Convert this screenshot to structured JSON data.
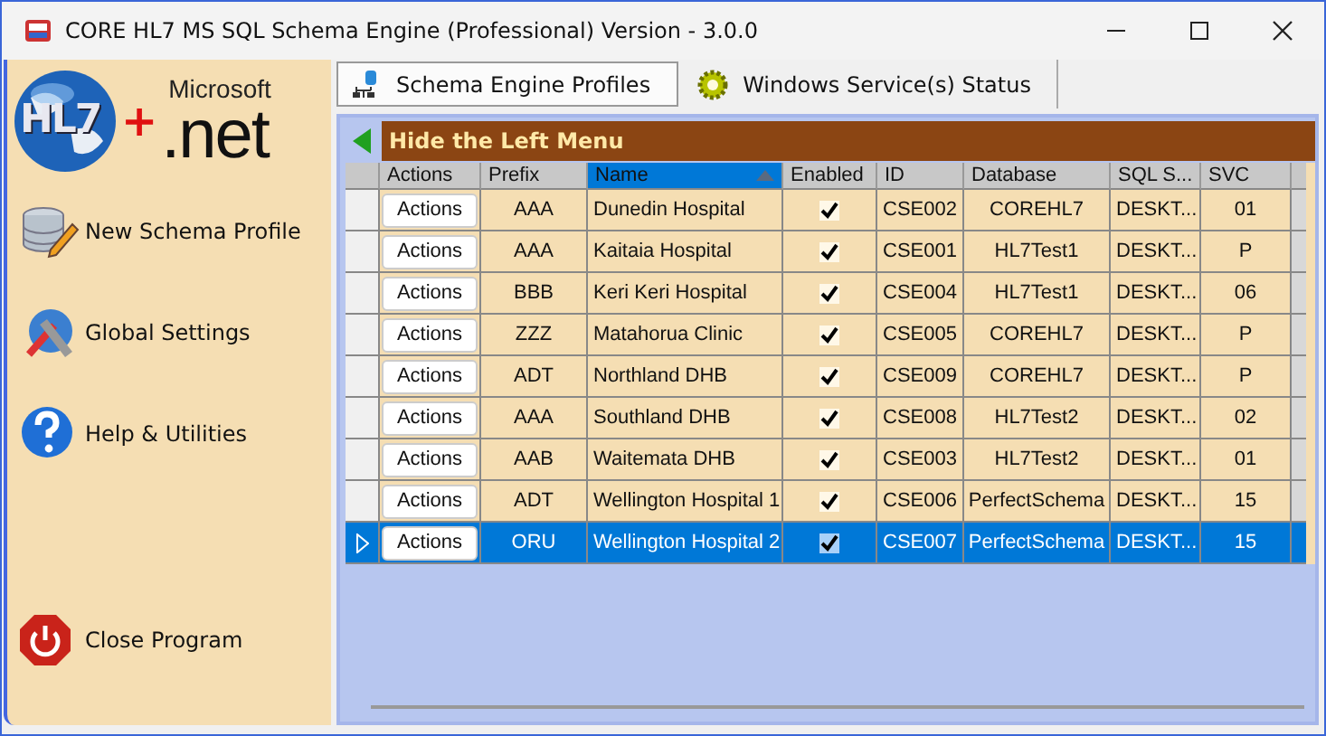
{
  "window": {
    "title": "CORE HL7 MS SQL Schema Engine (Professional) Version - 3.0.0"
  },
  "logo": {
    "left": "HL7",
    "plus": "+",
    "brand": "Microsoft",
    "right": ".net"
  },
  "sidebar": {
    "items": [
      {
        "label": "New Schema Profile",
        "kind": "database"
      },
      {
        "label": "Global Settings",
        "kind": "tools"
      },
      {
        "label": "Help & Utilities",
        "kind": "help"
      },
      {
        "label": "Close Program",
        "kind": "power"
      }
    ]
  },
  "tabs": [
    {
      "label": "Schema Engine Profiles",
      "kind": "profiles",
      "selected": true
    },
    {
      "label": "Windows Service(s) Status",
      "kind": "gear",
      "selected": false
    }
  ],
  "panel_header": {
    "label": "Hide the Left Menu"
  },
  "table": {
    "columns": [
      {
        "label": "Actions",
        "sorted": false
      },
      {
        "label": "Prefix",
        "sorted": false
      },
      {
        "label": "Name",
        "sorted": true
      },
      {
        "label": "Enabled",
        "sorted": false
      },
      {
        "label": "ID",
        "sorted": false
      },
      {
        "label": "Database",
        "sorted": false
      },
      {
        "label": "SQL S...",
        "sorted": false
      },
      {
        "label": "SVC",
        "sorted": false
      }
    ],
    "rows": [
      {
        "action": "Actions",
        "prefix": "AAA",
        "name": "Dunedin Hospital",
        "enabled": true,
        "id": "CSE002",
        "database": "COREHL7",
        "sql_server": "DESKT...",
        "svc": "01",
        "selected": false
      },
      {
        "action": "Actions",
        "prefix": "AAA",
        "name": "Kaitaia Hospital",
        "enabled": true,
        "id": "CSE001",
        "database": "HL7Test1",
        "sql_server": "DESKT...",
        "svc": "P",
        "selected": false
      },
      {
        "action": "Actions",
        "prefix": "BBB",
        "name": "Keri Keri Hospital",
        "enabled": true,
        "id": "CSE004",
        "database": "HL7Test1",
        "sql_server": "DESKT...",
        "svc": "06",
        "selected": false
      },
      {
        "action": "Actions",
        "prefix": "ZZZ",
        "name": "Matahorua Clinic",
        "enabled": true,
        "id": "CSE005",
        "database": "COREHL7",
        "sql_server": "DESKT...",
        "svc": "P",
        "selected": false
      },
      {
        "action": "Actions",
        "prefix": "ADT",
        "name": "Northland DHB",
        "enabled": true,
        "id": "CSE009",
        "database": "COREHL7",
        "sql_server": "DESKT...",
        "svc": "P",
        "selected": false
      },
      {
        "action": "Actions",
        "prefix": "AAA",
        "name": "Southland DHB",
        "enabled": true,
        "id": "CSE008",
        "database": "HL7Test2",
        "sql_server": "DESKT...",
        "svc": "02",
        "selected": false
      },
      {
        "action": "Actions",
        "prefix": "AAB",
        "name": "Waitemata DHB",
        "enabled": true,
        "id": "CSE003",
        "database": "HL7Test2",
        "sql_server": "DESKT...",
        "svc": "01",
        "selected": false
      },
      {
        "action": "Actions",
        "prefix": "ADT",
        "name": "Wellington Hospital 1",
        "enabled": true,
        "id": "CSE006",
        "database": "PerfectSchema",
        "sql_server": "DESKT...",
        "svc": "15",
        "selected": false
      },
      {
        "action": "Actions",
        "prefix": "ORU",
        "name": "Wellington Hospital 2",
        "enabled": true,
        "id": "CSE007",
        "database": "PerfectSchema",
        "sql_server": "DESKT...",
        "svc": "15",
        "selected": true
      }
    ]
  }
}
